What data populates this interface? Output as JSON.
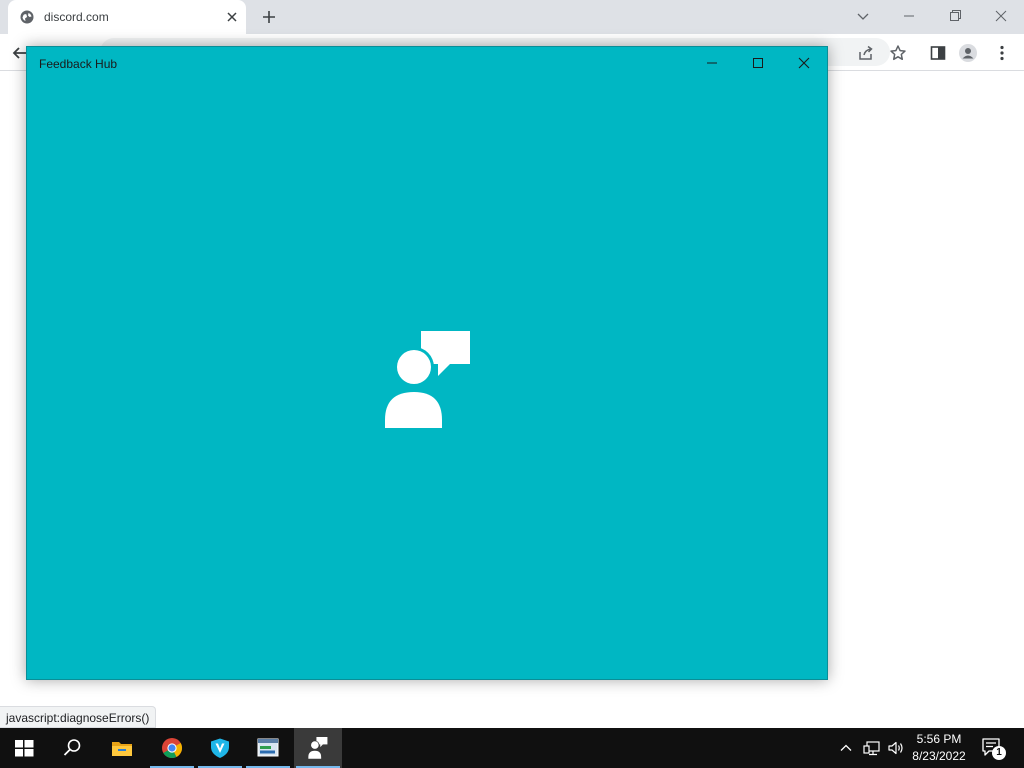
{
  "browser": {
    "tab": {
      "title": "discord.com"
    },
    "status_text": "javascript:diagnoseErrors()"
  },
  "feedback_hub": {
    "title": "Feedback Hub",
    "splash_icon": "person-feedback-icon",
    "background_color": "#00b7c3"
  },
  "taskbar": {
    "apps": [
      "start-icon",
      "search-icon",
      "file-explorer-icon",
      "chrome-icon",
      "vpn-shield-icon",
      "app-window-icon",
      "feedback-hub-icon"
    ],
    "clock": {
      "time": "5:56 PM",
      "date": "8/23/2022"
    },
    "notification_count": "1"
  }
}
